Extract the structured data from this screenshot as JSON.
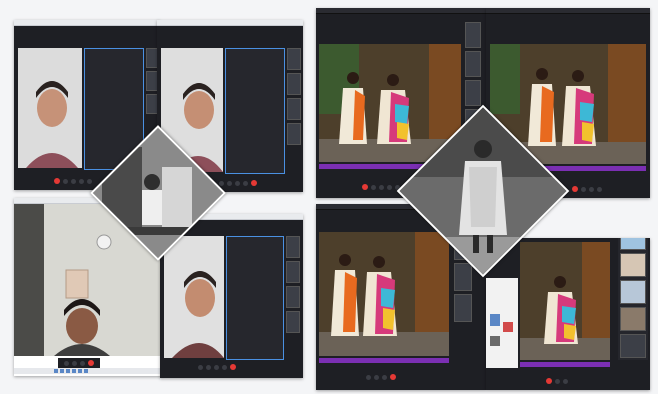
{
  "left_collage": {
    "topright_label": "",
    "name_tag": "",
    "taskbar_label": ""
  },
  "right_collage": {
    "title_label": "",
    "sidebar_label": ""
  },
  "colors": {
    "meeting_dark": "#1e1f24",
    "end_call_red": "#e53935",
    "progress_purple": "#7b2fb3",
    "frame_blue": "#4a90e2"
  },
  "icons": [
    "microphone-icon",
    "camera-icon",
    "share-screen-icon",
    "chat-icon",
    "participants-icon",
    "end-call-icon"
  ]
}
